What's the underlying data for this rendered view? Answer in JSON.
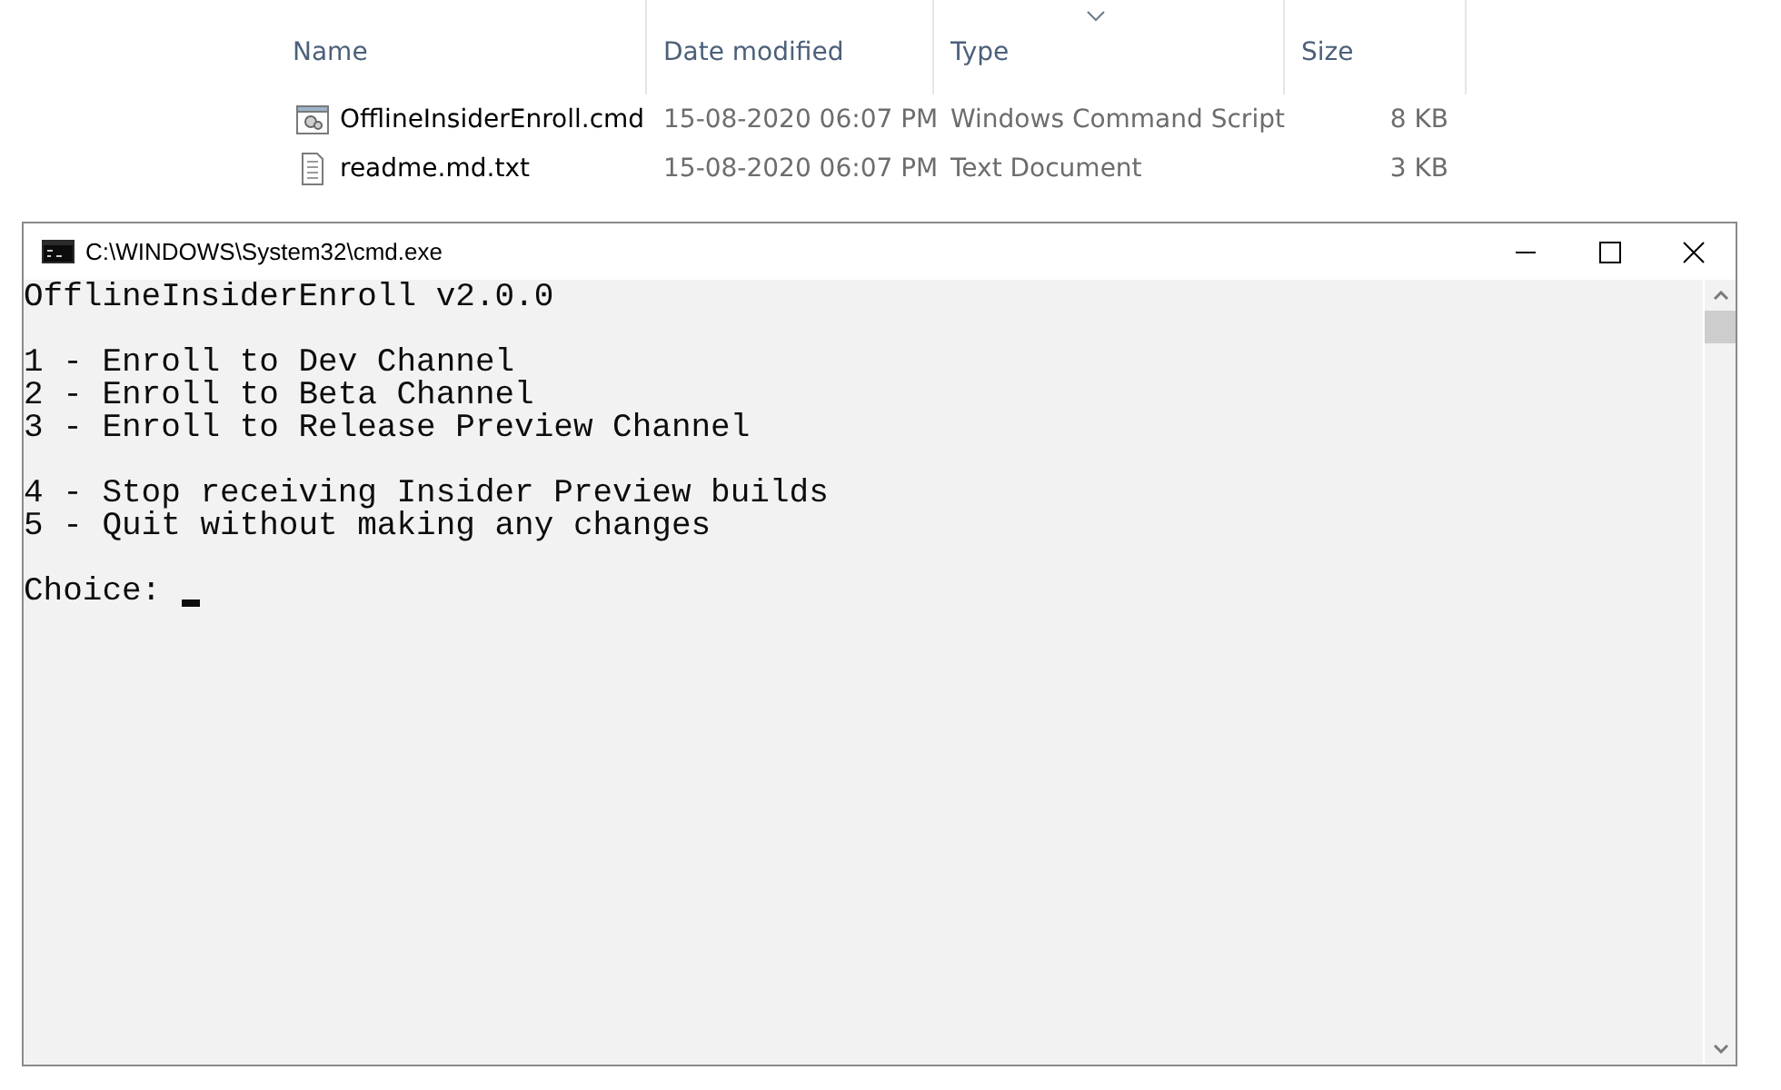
{
  "explorer": {
    "columns": [
      {
        "label": "Name",
        "sorted": false
      },
      {
        "label": "Date modified",
        "sorted": false
      },
      {
        "label": "Type",
        "sorted": true
      },
      {
        "label": "Size",
        "sorted": false
      }
    ],
    "files": [
      {
        "kind": "script",
        "name": "OfflineInsiderEnroll.cmd",
        "date": "15-08-2020 06:07 PM",
        "type": "Windows Command Script",
        "size": "8 KB"
      },
      {
        "kind": "text",
        "name": "readme.md.txt",
        "date": "15-08-2020 06:07 PM",
        "type": "Text Document",
        "size": "3 KB"
      }
    ]
  },
  "console": {
    "title": "C:\\WINDOWS\\System32\\cmd.exe",
    "blocks": [
      [
        "OfflineInsiderEnroll v2.0.0"
      ],
      [
        "1 - Enroll to Dev Channel",
        "2 - Enroll to Beta Channel",
        "3 - Enroll to Release Preview Channel"
      ],
      [
        "4 - Stop receiving Insider Preview builds",
        "5 - Quit without making any changes"
      ]
    ],
    "prompt": "Choice:"
  }
}
